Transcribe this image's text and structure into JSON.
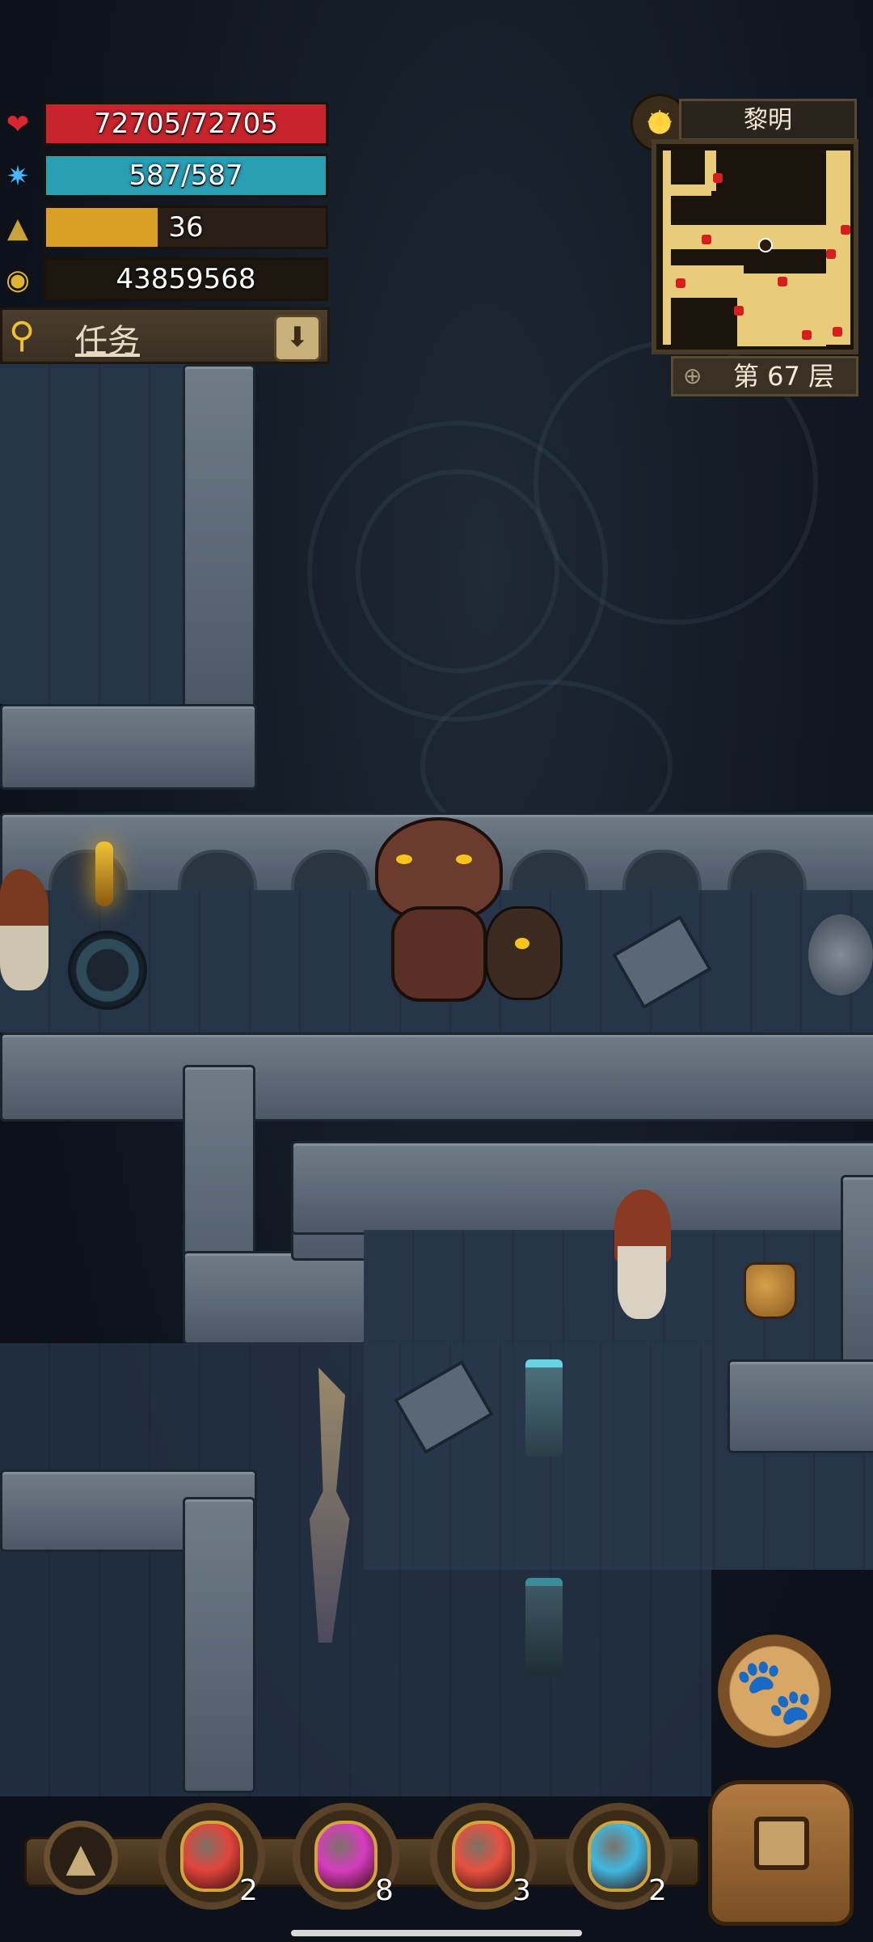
{
  "hud": {
    "hp": {
      "text": "72705/72705",
      "fill": 1.0,
      "color": "#c8242b"
    },
    "mp": {
      "text": "587/587",
      "fill": 1.0,
      "color": "#2a9fb4"
    },
    "level": {
      "text": "36",
      "fill": 0.4,
      "color": "#d8a125"
    },
    "gold": {
      "text": "43859568"
    }
  },
  "quest": {
    "label": "任务"
  },
  "minimap": {
    "time_label": "黎明",
    "floor_label": "第 67 层"
  },
  "items": [
    {
      "name": "red-potion",
      "count": "2",
      "color": "#e2443b"
    },
    {
      "name": "pink-potion",
      "count": "8",
      "color": "#d63cc0"
    },
    {
      "name": "red-gold-potion",
      "count": "3",
      "color": "#e85040"
    },
    {
      "name": "blue-potion",
      "count": "2",
      "color": "#3fb8e0"
    }
  ]
}
